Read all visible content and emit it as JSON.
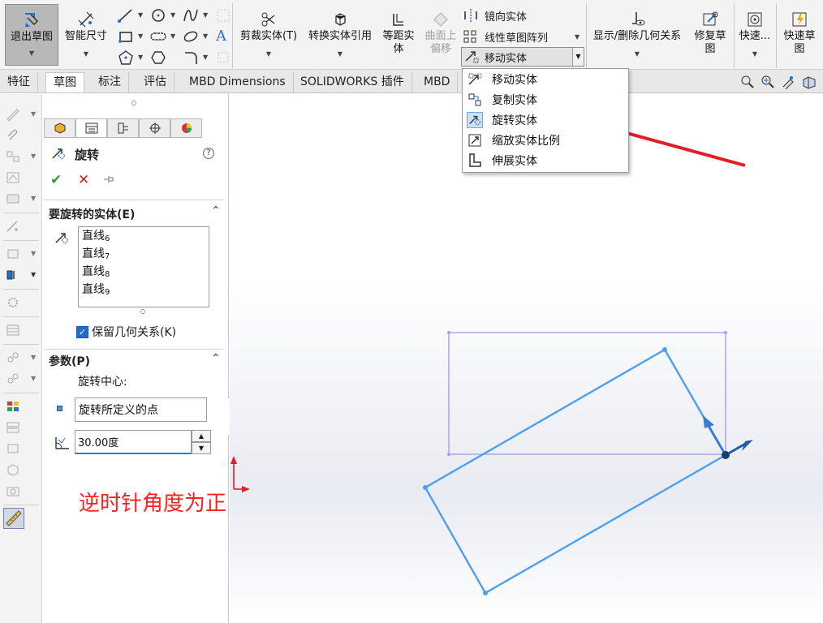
{
  "ribbon": {
    "exit_sketch": "退出草图",
    "smart_dimension": "智能尺寸",
    "trim": "剪裁实体(T)",
    "convert": "转换实体引用",
    "offset_line1": "等距实",
    "offset_line2": "体",
    "surface_offset_line1": "曲面上",
    "surface_offset_line2": "偏移",
    "mirror": "镜向实体",
    "linear_pattern": "线性草图阵列",
    "move_combo": "移动实体",
    "show_delete_relations": "显示/删除几何关系",
    "repair_line1": "修复草",
    "repair_line2": "图",
    "quick_snaps": "快速...",
    "rapid_line1": "快速草",
    "rapid_line2": "图"
  },
  "tabs": [
    "特征",
    "草图",
    "标注",
    "评估",
    "MBD Dimensions",
    "SOLIDWORKS 插件",
    "MBD"
  ],
  "active_tab": "草图",
  "menu": {
    "items": [
      "移动实体",
      "复制实体",
      "旋转实体",
      "缩放实体比例",
      "伸展实体"
    ],
    "selected": "旋转实体"
  },
  "pm": {
    "title": "旋转",
    "help": "?",
    "section1": "要旋转的实体(E)",
    "entities": [
      {
        "name": "直线",
        "num": "6"
      },
      {
        "name": "直线",
        "num": "7"
      },
      {
        "name": "直线",
        "num": "8"
      },
      {
        "name": "直线",
        "num": "9"
      }
    ],
    "keep_relations": "保留几何关系(K)",
    "section2": "参数(P)",
    "rotation_center_label": "旋转中心:",
    "rotation_center_value": "旋转所定义的点",
    "angle_value": "30.00度"
  },
  "annotation": {
    "text": "逆时针角度为正",
    "color": "#ff2020"
  },
  "colors": {
    "sketch_line": "#4a9ef0",
    "preview_line": "#9b8ff0",
    "arrow": "#e51c23",
    "accent": "#2a7bd4"
  }
}
